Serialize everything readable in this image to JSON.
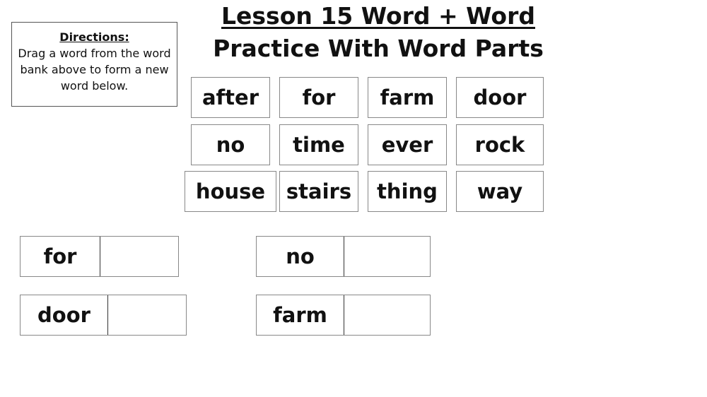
{
  "title": {
    "line1": "Lesson 15 Word + Word",
    "line2": "Practice With Word Parts"
  },
  "directions": {
    "heading": "Directions:",
    "text": "Drag a word from the word bank above to form a new word below."
  },
  "word_bank": [
    "after",
    "for",
    "farm",
    "door",
    "no",
    "time",
    "ever",
    "rock",
    "house",
    "stairs",
    "thing",
    "way"
  ],
  "targets": [
    {
      "word": "for",
      "answer": ""
    },
    {
      "word": "no",
      "answer": ""
    },
    {
      "word": "door",
      "answer": ""
    },
    {
      "word": "farm",
      "answer": ""
    }
  ]
}
